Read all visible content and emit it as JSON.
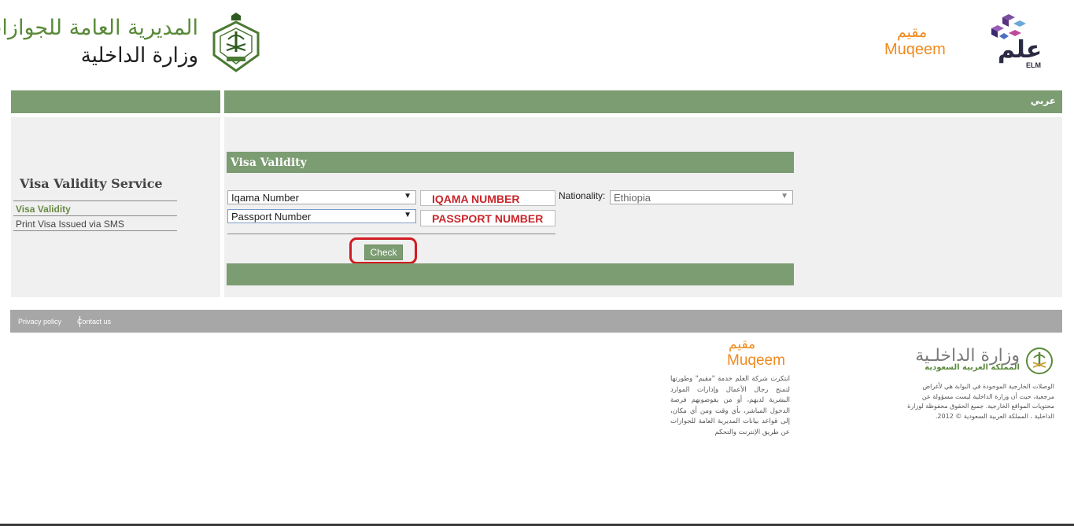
{
  "header": {
    "gdp_title_ar": "المديرية العامة للجوازات",
    "ministry_ar": "وزارة الداخلية",
    "muqeem_ar": "مقيم",
    "muqeem_en": "Muqeem",
    "elm_ar": "علم",
    "elm_en": "ELM",
    "language_link": "عربي"
  },
  "sidebar": {
    "title": "Visa Validity Service",
    "items": [
      {
        "label": "Visa Validity",
        "active": true
      },
      {
        "label": "Print Visa Issued via SMS",
        "active": false
      }
    ]
  },
  "form": {
    "heading": "Visa Validity",
    "id_type_select": "Iqama Number",
    "id_value": "IQAMA NUMBER",
    "doc_type_select": "Passport Number",
    "doc_value": "PASSPORT NUMBER",
    "nationality_label": "Nationality:",
    "nationality_value": "Ethiopia",
    "check_button": "Check"
  },
  "footer": {
    "privacy_link": "Privacy policy",
    "contact_link": "Contact us",
    "muqeem_ar": "مقيم",
    "muqeem_en": "Muqeem",
    "muqeem_description": "ابتكرت شركة العلم خدمة \"مقيم\" وطورتها لتمنح رجال الأعمال وإدارات الموارد البشرية لديهم، أو من يفوضونهم فرصة الدخول المباشر، بأي وقت ومن أي مكان، إلى قواعد بيانات المديرية العامة للجوازات عن طريق الإنترنت والتحكم",
    "moi_title_ar": "وزارة الداخلـية",
    "moi_subtitle_ar": "المملكة العربية السعودية",
    "moi_description": "الوصلات الخارجية الموجودة في البوابة هي لأغراض مرجعية، حيث أن وزارة الداخلية ليست مسؤولة عن محتويات المواقع الخارجية. جميع الحقوق محفوظة لوزارة الداخلية ، المملكة العربية السعودية © 2012."
  },
  "colors": {
    "green_bar": "#7c9c72",
    "muqeem_orange": "#f08a1d",
    "highlight_red": "#d11b22",
    "footer_gray": "#a7a7a7"
  }
}
